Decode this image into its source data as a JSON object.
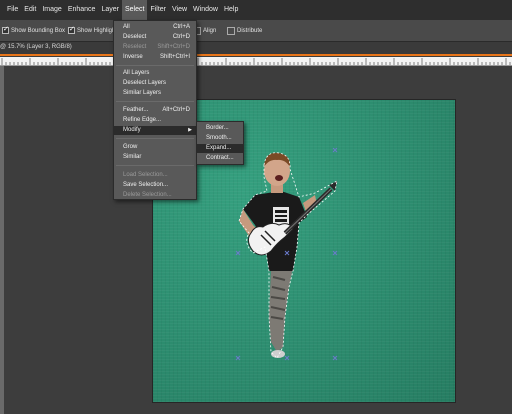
{
  "menubar": [
    "File",
    "Edit",
    "Image",
    "Enhance",
    "Layer",
    "Select",
    "Filter",
    "View",
    "Window",
    "Help"
  ],
  "menubar_active": "Select",
  "options": {
    "show_bounding_box": "Show Bounding Box",
    "show_highlight": "Show Highlight",
    "align": "Align",
    "distribute": "Distribute"
  },
  "doc_tab": "@ 15.7% (Layer 3, RGB/8)",
  "select_menu": {
    "all": "All",
    "all_sc": "Ctrl+A",
    "deselect": "Deselect",
    "deselect_sc": "Ctrl+D",
    "reselect": "Reselect",
    "reselect_sc": "Shift+Ctrl+D",
    "inverse": "Inverse",
    "inverse_sc": "Shift+Ctrl+I",
    "all_layers": "All Layers",
    "deselect_layers": "Deselect Layers",
    "similar_layers": "Similar Layers",
    "feather": "Feather...",
    "feather_sc": "Alt+Ctrl+D",
    "refine_edge": "Refine Edge...",
    "modify": "Modify",
    "grow": "Grow",
    "similar": "Similar",
    "load_selection": "Load Selection...",
    "save_selection": "Save Selection...",
    "delete_selection": "Delete Selection..."
  },
  "modify_submenu": {
    "border": "Border...",
    "smooth": "Smooth...",
    "expand": "Expand...",
    "contract": "Contract..."
  },
  "colors": {
    "canvas": "#2f9272",
    "accent": "#e8751a"
  }
}
